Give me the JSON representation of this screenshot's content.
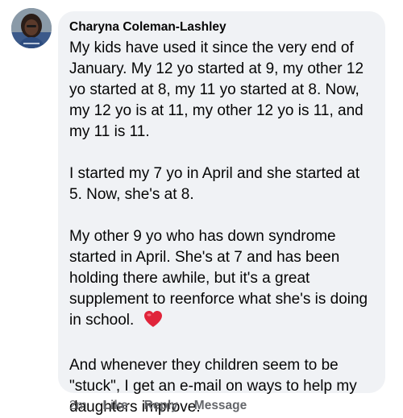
{
  "comment": {
    "author": "Charyna Coleman-Lashley",
    "paragraphs": [
      "My kids have used it since the very end of January.  My 12 yo started at 9, my other 12 yo started at 8, my 11 yo started at 8.  Now, my 12 yo is at 11, my other 12 yo is 11, and my 11 is 11.",
      "I started my 7 yo in April and she started at 5.  Now, she's at 8.",
      "My other 9 yo who has down syndrome started in April.  She's at 7 and has been holding there awhile, but it's a great supplement to reenforce what she's is doing in school.",
      "And whenever they children seem to be \"stuck\", I get an e-mail on ways to help my daughters improve."
    ],
    "emoji": "heart-emoji"
  },
  "actions": {
    "timestamp": "2m",
    "like": "Like",
    "reply": "Reply",
    "message": "Message"
  },
  "colors": {
    "bubble_bg": "#f0f2f5",
    "text": "#050505",
    "secondary_text": "#65676b",
    "heart": "#e0243a"
  }
}
